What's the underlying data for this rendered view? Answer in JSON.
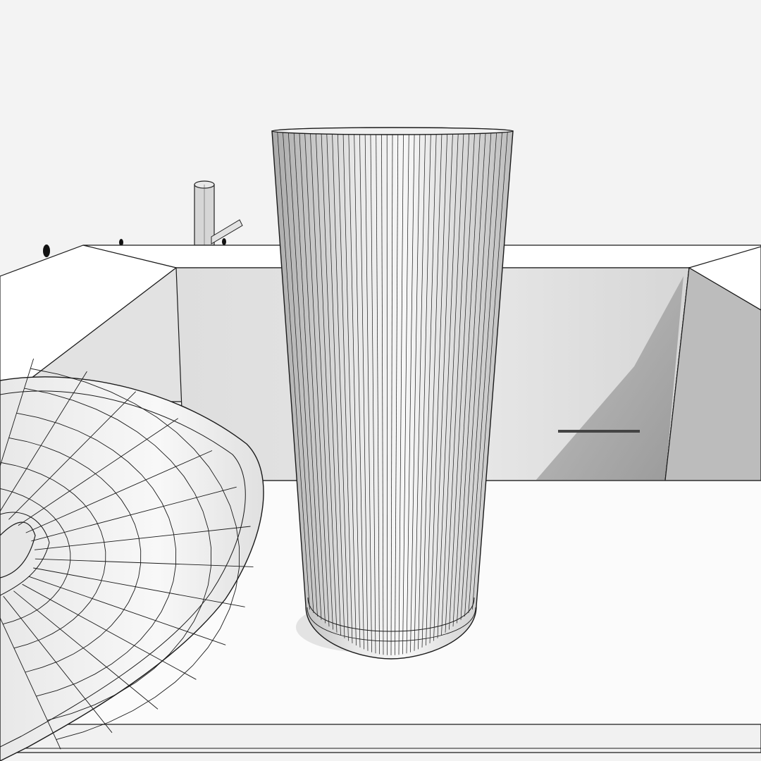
{
  "scene": {
    "kind": "3d-wireframe-render",
    "style": "grayscale-clay-with-mesh-edges",
    "objects": [
      {
        "id": "tall-glass",
        "label": "",
        "shape": "tapered-cylinder"
      },
      {
        "id": "plate",
        "label": "",
        "shape": "curved-disc"
      },
      {
        "id": "counter",
        "label": "",
        "shape": "box-with-recess"
      },
      {
        "id": "background-post",
        "label": "",
        "shape": "cylinder"
      }
    ],
    "colors": {
      "background": "#f3f3f3",
      "surface_light": "#ffffff",
      "surface_mid": "#e4e4e4",
      "surface_shadow": "#9a9a9a",
      "edge": "#1a1a1a"
    }
  }
}
